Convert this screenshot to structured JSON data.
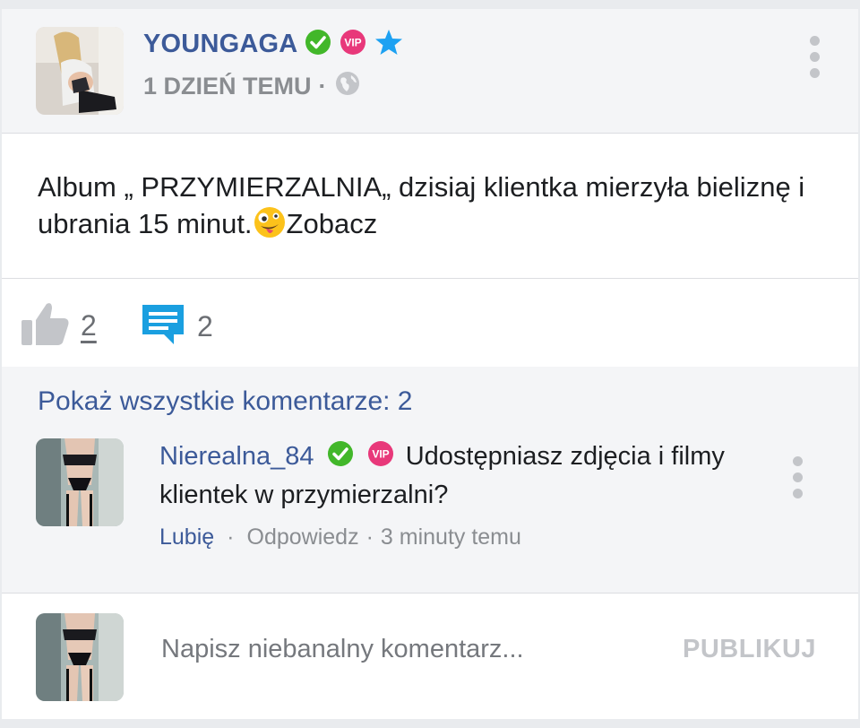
{
  "post": {
    "author": "YOUNGAGA",
    "time": "1 DZIEŃ TEMU",
    "separator": "·",
    "text": "Album „ PRZYMIERZALNIA„ dzisiaj klientka mierzyła bieliznę i ubrania 15 minut.",
    "text_after_emoji": "Zobacz",
    "emoji": "zany-face",
    "badges": [
      "verified-check",
      "vip",
      "star"
    ],
    "privacy_icon": "globe-icon"
  },
  "actions": {
    "likes": "2",
    "comments": "2"
  },
  "comments": {
    "show_all": "Pokaż wszystkie komentarze: 2",
    "items": [
      {
        "author": "Nierealna_84",
        "text": "Udostępniasz zdjęcia i filmy klientek w przymierzalni?",
        "like": "Lubię",
        "dot1": "·",
        "reply": "Odpowiedz",
        "dot2": "·",
        "time": "3 minuty temu"
      }
    ]
  },
  "compose": {
    "placeholder": "Napisz niebanalny komentarz...",
    "publish": "PUBLIKUJ"
  },
  "colors": {
    "link_blue": "#3c5a99",
    "verified_green": "#42b72a",
    "vip_pink": "#e8387a",
    "star_blue": "#1da1f2",
    "comment_icon_blue": "#1a9fe0"
  }
}
